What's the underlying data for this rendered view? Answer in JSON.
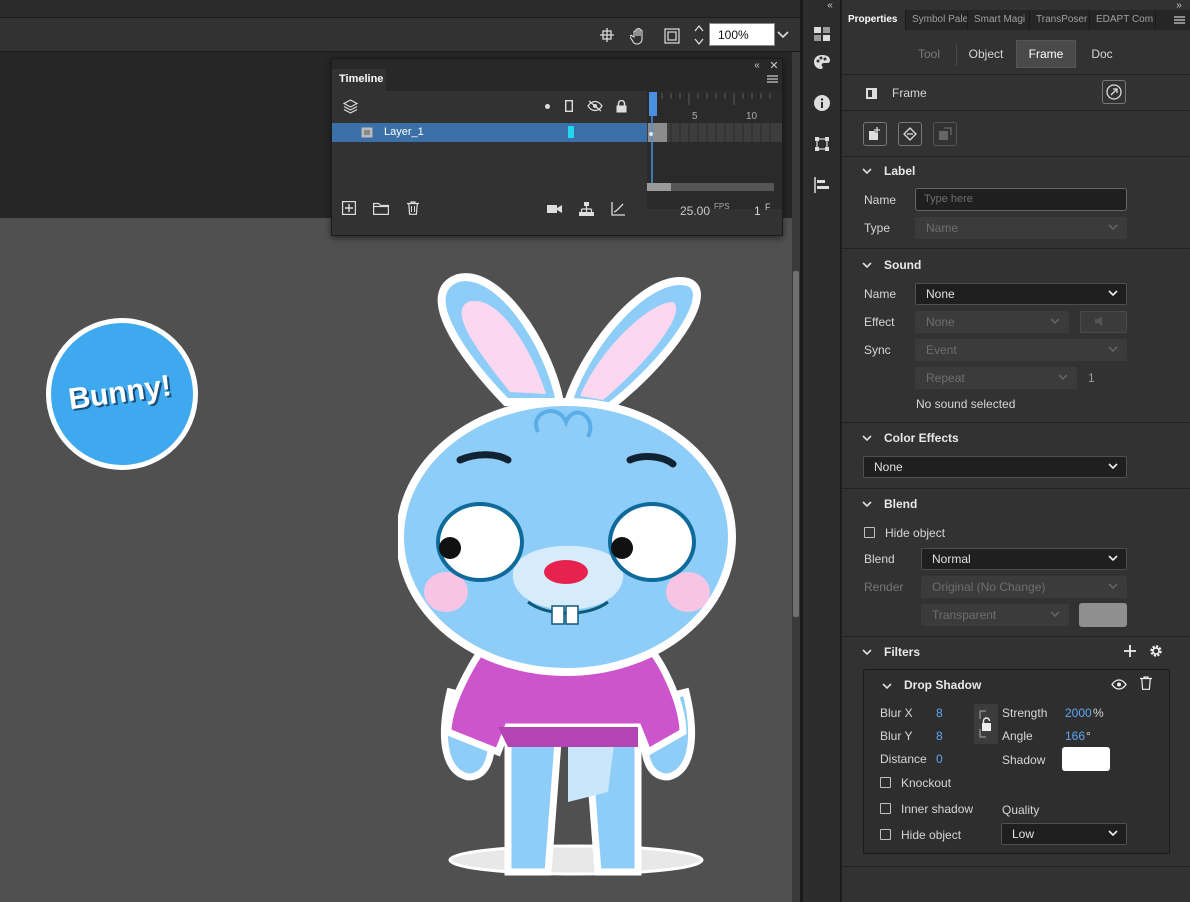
{
  "toolbar": {
    "zoom_value": "100%"
  },
  "timeline": {
    "tab_label": "Timeline",
    "layer_name": "Layer_1",
    "ruler_marks": [
      "5",
      "10"
    ],
    "fps_value": "25.00",
    "fps_label": "FPS",
    "frame_value": "1",
    "frame_label": "F",
    "icons": [
      "layers-icon",
      "onion-dot-icon",
      "outline-icon",
      "eye-hide-icon",
      "lock-icon",
      "new-layer-icon",
      "folder-icon",
      "trash-icon",
      "camera-icon",
      "parenting-icon",
      "graph-icon"
    ]
  },
  "side_icons": [
    "swatches-icon",
    "palette-icon",
    "info-icon",
    "transform-icon",
    "align-icon"
  ],
  "properties": {
    "tabs": [
      "Properties",
      "Symbol Pale",
      "Smart Magi",
      "TransPoser",
      "EDAPT Com"
    ],
    "modes": [
      "Tool",
      "Object",
      "Frame",
      "Doc"
    ],
    "active_mode": "Frame",
    "object_type": "Frame",
    "label_section": {
      "title": "Label",
      "name_label": "Name",
      "name_placeholder": "Type here",
      "type_label": "Type",
      "type_value": "Name"
    },
    "sound_section": {
      "title": "Sound",
      "name_label": "Name",
      "name_value": "None",
      "effect_label": "Effect",
      "effect_value": "None",
      "sync_label": "Sync",
      "sync_value": "Event",
      "repeat_value": "Repeat",
      "repeat_count": "1",
      "status": "No sound selected"
    },
    "color_effects": {
      "title": "Color Effects",
      "value": "None"
    },
    "blend_section": {
      "title": "Blend",
      "hide_object": "Hide object",
      "blend_label": "Blend",
      "blend_value": "Normal",
      "render_label": "Render",
      "render_value": "Original (No Change)",
      "transparent_value": "Transparent"
    },
    "filters": {
      "title": "Filters",
      "drop_shadow": {
        "title": "Drop Shadow",
        "blur_x_label": "Blur X",
        "blur_x": "8",
        "blur_y_label": "Blur Y",
        "blur_y": "8",
        "distance_label": "Distance",
        "distance": "0",
        "strength_label": "Strength",
        "strength": "2000",
        "strength_unit": "%",
        "angle_label": "Angle",
        "angle": "166",
        "angle_unit": "°",
        "shadow_label": "Shadow",
        "shadow_color": "#ffffff",
        "knockout": "Knockout",
        "inner_shadow": "Inner shadow",
        "hide_object": "Hide object",
        "quality_label": "Quality",
        "quality_value": "Low"
      }
    }
  },
  "stage": {
    "badge_text": "Bunny!",
    "badge_color": "#3fa9ef",
    "bunny_color": "#8ecdf7",
    "shirt_color": "#cc55cc"
  },
  "colors": {
    "accent": "#3a6fa8",
    "playhead": "#4a8ee0"
  }
}
